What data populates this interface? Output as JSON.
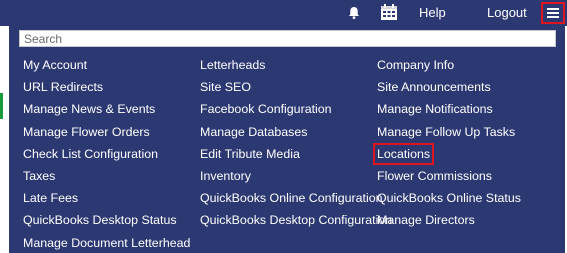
{
  "topbar": {
    "help_label": "Help",
    "logout_label": "Logout",
    "bell_icon": "bell-icon",
    "calendar_icon": "calendar-icon",
    "menu_icon": "hamburger-menu-icon"
  },
  "colors": {
    "bar_bg": "#2c3871",
    "panel_bg": "#2c3871",
    "highlight": "#e0141e",
    "link_text": "#ffffff"
  },
  "search": {
    "placeholder": "Search",
    "value": ""
  },
  "menu": {
    "col1": [
      "My Account",
      "URL Redirects",
      "Manage News & Events",
      "Manage Flower Orders",
      "Check List Configuration",
      "Taxes",
      "Late Fees",
      "QuickBooks Desktop Status",
      "Manage Document Letterhead"
    ],
    "col2": [
      "Letterheads",
      "Site SEO",
      "Facebook Configuration",
      "Manage Databases",
      "Edit Tribute Media",
      "Inventory",
      "QuickBooks Online Configuration",
      "QuickBooks Desktop Configuration"
    ],
    "col3": [
      "Company Info",
      "Site Announcements",
      "Manage Notifications",
      "Manage Follow Up Tasks",
      "Locations",
      "Flower Commissions",
      "QuickBooks Online Status",
      "Manage Directors"
    ]
  }
}
